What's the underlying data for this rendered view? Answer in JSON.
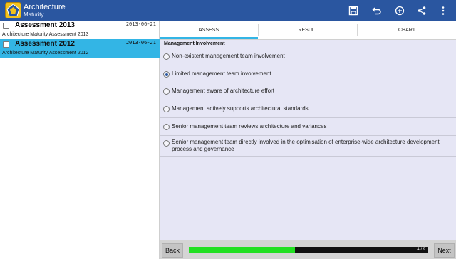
{
  "app": {
    "title": "Architecture",
    "subtitle": "Maturity",
    "icons": [
      "app-logo-icon",
      "save-icon",
      "undo-icon",
      "add-icon",
      "share-icon",
      "overflow-menu-icon"
    ]
  },
  "assessments": [
    {
      "title": "Assessment 2013",
      "date": "2013-06-21",
      "subtitle": "Architecture Maturity Assessment 2013",
      "selected": false
    },
    {
      "title": "Assessment 2012",
      "date": "2013-06-21",
      "subtitle": "Architecture Maturity Assessment 2012",
      "selected": true
    }
  ],
  "tabs": [
    {
      "label": "ASSESS",
      "active": true
    },
    {
      "label": "RESULT",
      "active": false
    },
    {
      "label": "CHART",
      "active": false
    }
  ],
  "question": {
    "label": "Management Involvement",
    "options": [
      {
        "text": "Non-existent management team involvement",
        "checked": false
      },
      {
        "text": "Limited management team involvement",
        "checked": true
      },
      {
        "text": "Management aware of architecture effort",
        "checked": false
      },
      {
        "text": "Management actively supports architectural standards",
        "checked": false
      },
      {
        "text": "Senior management team reviews architecture and variances",
        "checked": false
      },
      {
        "text": "Senior management team directly involved in the optimisation of enterprise-wide architecture development process and governance",
        "checked": false
      }
    ]
  },
  "footer": {
    "back_label": "Back",
    "next_label": "Next",
    "progress_text": "4 / 9",
    "progress_fraction": 0.444
  },
  "colors": {
    "action_bar": "#2a56a0",
    "selected_item": "#33b5e5",
    "progress_fill": "#22e022"
  }
}
